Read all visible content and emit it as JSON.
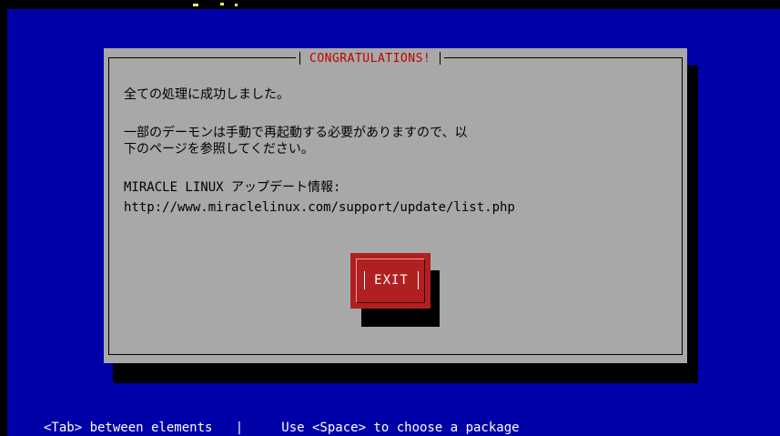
{
  "dialog": {
    "title": "CONGRATULATIONS!",
    "lines": [
      "全ての処理に成功しました。",
      "一部のデーモンは手動で再起動する必要がありますので、以",
      "下のページを参照してください。",
      "MIRACLE LINUX アップデート情報:",
      "http://www.miraclelinux.com/support/update/list.php"
    ],
    "exit_label": "EXIT"
  },
  "footer": {
    "help_text": "<Tab> between elements   |     Use <Space> to choose a package"
  },
  "colors": {
    "background": "#0000a8",
    "dialog": "#a8a8a8",
    "title": "#c00000",
    "button": "#b02020",
    "footer_text": "#ffffff"
  }
}
